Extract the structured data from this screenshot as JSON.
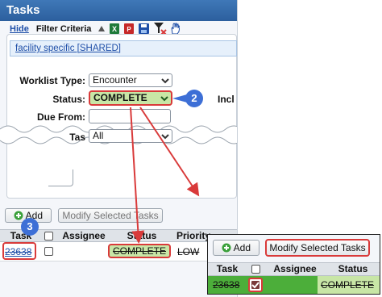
{
  "panel": {
    "title": "Tasks",
    "criteria": {
      "hide_link": "Hide",
      "title": "Filter Criteria",
      "facility_link": "facility specific [SHARED]",
      "worklist_type_label": "Worklist Type:",
      "worklist_type_value": "Encounter",
      "status_label": "Status:",
      "status_value": "COMPLETE",
      "truncated_label": "Incl",
      "due_from_label": "Due From:",
      "task_label": "Tas",
      "task_value": "All"
    },
    "toolbar_icons": [
      "triangle-up-icon",
      "excel-icon",
      "pdf-icon",
      "save-icon",
      "clear-filter-icon",
      "hand-icon"
    ],
    "grid_toolbar": {
      "add_label": "Add",
      "modify_label": "Modify Selected Tasks"
    },
    "grid": {
      "headers": {
        "task": "Task",
        "assignee": "Assignee",
        "status": "Status",
        "priority": "Priority"
      },
      "row": {
        "task": "23638",
        "assignee": "",
        "status": "COMPLETE",
        "priority": "LOW"
      }
    }
  },
  "inset": {
    "add_label": "Add",
    "modify_label": "Modify Selected Tasks",
    "headers": {
      "task": "Task",
      "assignee": "Assignee",
      "status": "Status"
    },
    "row": {
      "task": "23638",
      "status": "COMPLETE",
      "checked": true
    }
  },
  "callouts": {
    "status_step": "2",
    "task_step": "3"
  },
  "colors": {
    "header_blue": "#2c5f9e",
    "callout_blue": "#3d6fd6",
    "highlight_red": "#d93a3a",
    "complete_green": "#c8e6a6",
    "row_green": "#4cae3a"
  }
}
